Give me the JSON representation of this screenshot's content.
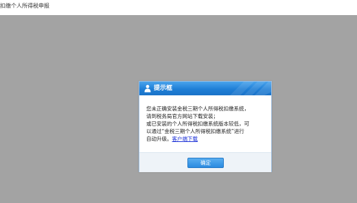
{
  "page": {
    "title": "扣缴个人所得税申报"
  },
  "dialog": {
    "title": "提示框",
    "icon": "person-icon",
    "message_lines": [
      "您未正确安装金税三期个人所得税扣缴系统，",
      "请到税务局官方网站下载安装；",
      "或已安装的个人所得税扣缴系统版本较低，可",
      "以通过“金税三期个人所得税扣缴系统”进行"
    ],
    "message_last_prefix": "自动升级。",
    "link_text": "客户端下载",
    "confirm_label": "确定"
  },
  "colors": {
    "overlay": "#a3a3a3",
    "header_blue": "#1f7fd6",
    "link": "#1a2fd6"
  }
}
